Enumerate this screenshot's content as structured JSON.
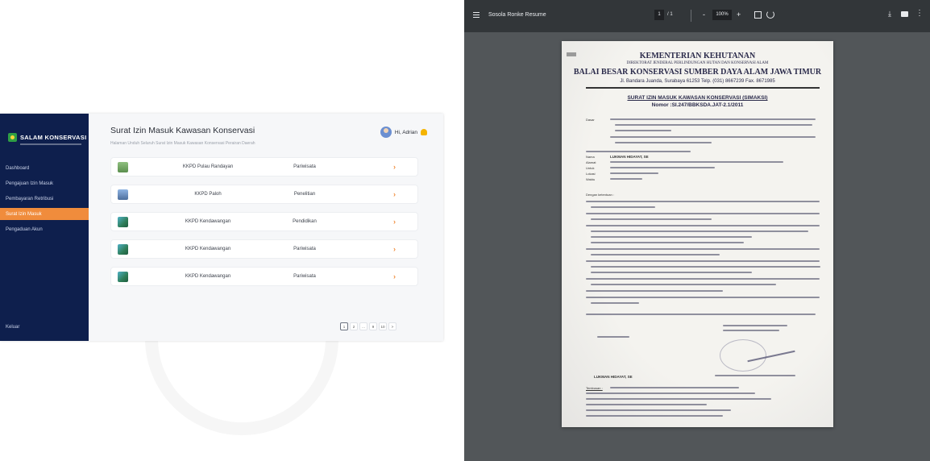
{
  "app": {
    "brand": "SALAM KONSERVASI",
    "nav": [
      "Dashboard",
      "Pengajuan Izin Masuk",
      "Pembayaran Retribusi",
      "Surat Izin Masuk",
      "Pengaduan Akun"
    ],
    "active_nav_index": 3,
    "logout": "Keluar",
    "page_title": "Surat Izin Masuk Kawasan Konservasi",
    "page_subtitle": "Halaman Unduh Seluruh Surat Izin Masuk Kawasan Konservasi Perairan Daerah",
    "user_greeting": "Hi, Adrian",
    "rows": [
      {
        "place": "KKPD Pulau Randayan",
        "purpose": "Pariwisata",
        "thumb": "t1"
      },
      {
        "place": "KKPD Paloh",
        "purpose": "Penelitian",
        "thumb": "t2"
      },
      {
        "place": "KKPD Kendawangan",
        "purpose": "Pendidikan",
        "thumb": "t3"
      },
      {
        "place": "KKPD Kendawangan",
        "purpose": "Pariwisata",
        "thumb": "t3"
      },
      {
        "place": "KKPD Kendawangan",
        "purpose": "Pariwisata",
        "thumb": "t3"
      }
    ],
    "pagination": [
      "1",
      "2",
      "...",
      "9",
      "10",
      ">"
    ],
    "accent_color": "#f08c3c",
    "sidebar_color": "#0e1f4d"
  },
  "viewer": {
    "doc_title": "Sosola Ronke Resume",
    "page_current": "1",
    "page_total": "/ 1",
    "zoom": "100%",
    "zoom_minus": "-",
    "zoom_plus": "+",
    "icons": [
      "menu-icon",
      "fit-page-icon",
      "rotate-icon",
      "download-icon",
      "print-icon",
      "more-icon"
    ]
  },
  "document": {
    "h1": "KEMENTERIAN KEHUTANAN",
    "h2": "DIREKTORAT JENDERAL PERLINDUNGAN HUTAN DAN KONSERVASI ALAM",
    "h3": "BALAI BESAR KONSERVASI SUMBER DAYA ALAM JAWA TIMUR",
    "address": "Jl. Bandara Juanda, Surabaya 61253 Telp. (031) 8667239 Fax. 8671985",
    "subject": "SURAT IZIN MASUK KAWASAN KONSERVASI (SIMAKSI)",
    "number": "Nomor :SI.247/BBKSDA.JAT-2.1/2011",
    "dasar": "Dasar",
    "nama_label": "Nama",
    "nama": "LUKMAN HIDAYAT, SE",
    "alamat_label": "Alamat",
    "untuk_label": "Untuk",
    "lokasi_label": "Lokasi",
    "waktu_label": "Waktu",
    "dengan": "Dengan ketentuan :",
    "signer_left": "LUKMAN HIDAYAT, SE",
    "tembusan": "Tembusan :"
  }
}
